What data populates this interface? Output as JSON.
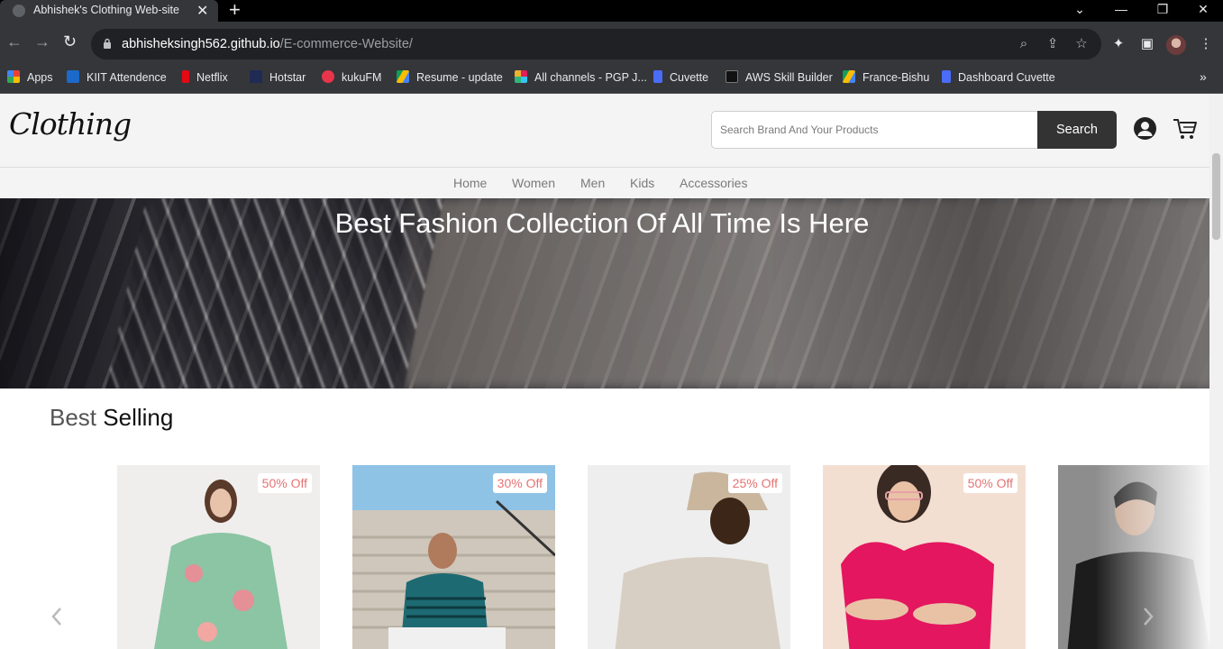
{
  "browser": {
    "tab_title": "Abhishek's Clothing Web-site",
    "url_host": "abhisheksingh562.github.io",
    "url_path": "/E-commerce-Website/",
    "bookmarks": [
      {
        "label": "Apps",
        "icon": "apps-grid-icon",
        "color": "#ea4335"
      },
      {
        "label": "KIIT Attendence",
        "icon": "sap-icon",
        "color": "#1b6ac9"
      },
      {
        "label": "Netflix",
        "icon": "netflix-icon",
        "color": "#e50914"
      },
      {
        "label": "Hotstar",
        "icon": "hotstar-icon",
        "color": "#1f2a55"
      },
      {
        "label": "kukuFM",
        "icon": "kukufm-icon",
        "color": "#e8354b"
      },
      {
        "label": "Resume - update",
        "icon": "google-drive-icon",
        "color": "#fbbc04"
      },
      {
        "label": "All channels - PGP J...",
        "icon": "slack-icon",
        "color": "#e01e5a"
      },
      {
        "label": "Cuvette",
        "icon": "cuvette-icon",
        "color": "#4a6cf7"
      },
      {
        "label": "AWS Skill Builder",
        "icon": "aws-icon",
        "color": "#232f3e"
      },
      {
        "label": "France-Bishu",
        "icon": "google-drive-icon",
        "color": "#0f9d58"
      },
      {
        "label": "Dashboard Cuvette",
        "icon": "cuvette-icon",
        "color": "#4a6cf7"
      }
    ]
  },
  "site": {
    "logo": "Clothing",
    "search": {
      "placeholder": "Search Brand And Your Products",
      "button": "Search"
    },
    "nav": [
      "Home",
      "Women",
      "Men",
      "Kids",
      "Accessories"
    ],
    "hero_title": "Best Fashion Collection Of All Time Is Here",
    "section": {
      "light": "Best",
      "bold": "Selling"
    },
    "products": [
      {
        "badge": "50% Off",
        "image": "floral-dress-woman"
      },
      {
        "badge": "30% Off",
        "image": "man-on-stairs-tshirt"
      },
      {
        "badge": "25% Off",
        "image": "beige-sweatshirt-bucket-hat"
      },
      {
        "badge": "50% Off",
        "image": "pink-puff-sleeve-top"
      },
      {
        "badge": "",
        "image": "black-shirt-man"
      }
    ],
    "accent_color": "#e57373"
  }
}
